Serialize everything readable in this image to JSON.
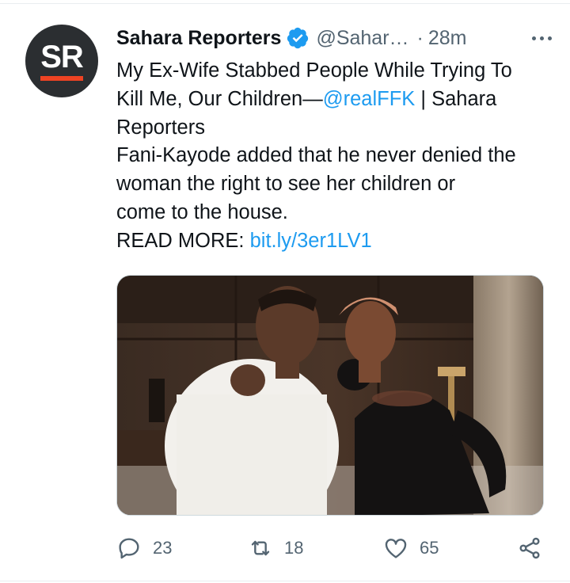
{
  "tweet": {
    "avatar_text": "SR",
    "display_name": "Sahara Reporters",
    "handle": "@Sahar…",
    "separator": "·",
    "time": "28m",
    "body": {
      "line1": "My Ex-Wife Stabbed People While Trying To",
      "line2_pre": "Kill Me, Our Children—",
      "mention": "@realFFK",
      "line2_post": " | Sahara",
      "line3": "Reporters",
      "line4": "Fani-Kayode added that he never denied the",
      "line5": "woman the right to see her children or",
      "line6": "come to the house.",
      "read_more_label": "READ MORE: ",
      "read_more_link": "bit.ly/3er1LV1"
    },
    "photo": {
      "alt": ""
    }
  },
  "actions": {
    "reply_count": "23",
    "retweet_count": "18",
    "like_count": "65"
  },
  "icons": [
    "verified-icon",
    "more-icon",
    "reply-icon",
    "retweet-icon",
    "like-icon",
    "share-icon"
  ],
  "colors": {
    "accent": "#1d9bf0",
    "muted": "#536471",
    "text": "#0f1419",
    "brand_orange": "#ee4323",
    "avatar_bg": "#2b2e31"
  }
}
